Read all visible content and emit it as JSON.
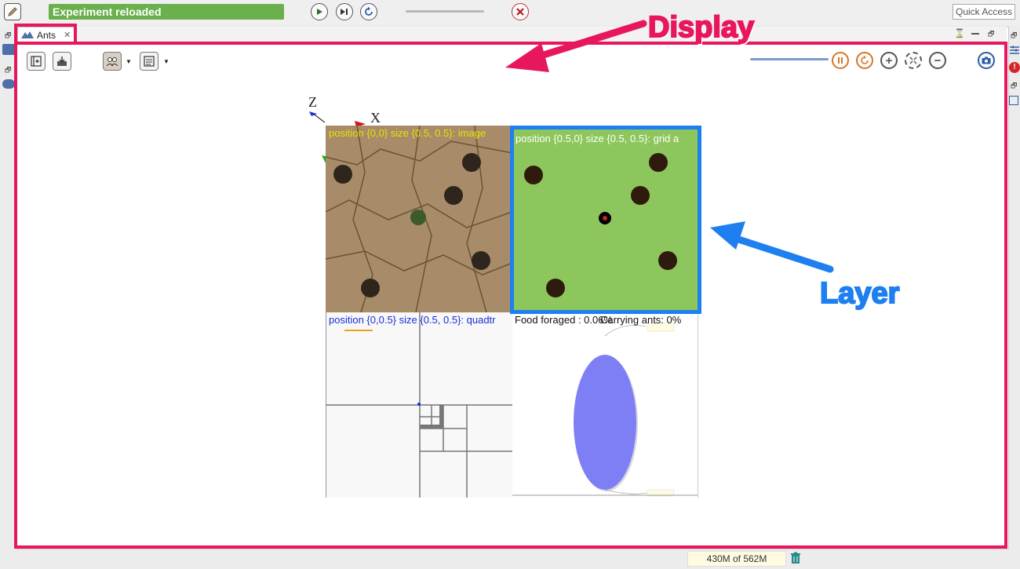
{
  "toolbar": {
    "status": "Experiment reloaded",
    "quick_access": "Quick Access",
    "icons": [
      "edit-icon",
      "play-icon",
      "step-icon",
      "reload-icon",
      "close-icon"
    ]
  },
  "tab": {
    "label": "Ants"
  },
  "display": {
    "axis_z": "Z",
    "axis_x": "X",
    "layers": {
      "image": "position {0,0} size {0.5, 0.5}: image",
      "grid": "position {0.5,0} size {0.5, 0.5}: grid a",
      "quadtree": "position {0,0.5} size {0.5, 0.5}: quadtr",
      "chart_food": "Food foraged : 0.06%",
      "chart_carrying": "Carrying ants: 0%"
    }
  },
  "annotations": {
    "display": "Display",
    "layer": "Layer"
  },
  "footer": {
    "memory": "430M of 562M"
  },
  "colors": {
    "accent_pink": "#e8175d",
    "accent_blue": "#1e7ff0",
    "status_green": "#6ab04c",
    "grid_green": "#8dc65c"
  }
}
